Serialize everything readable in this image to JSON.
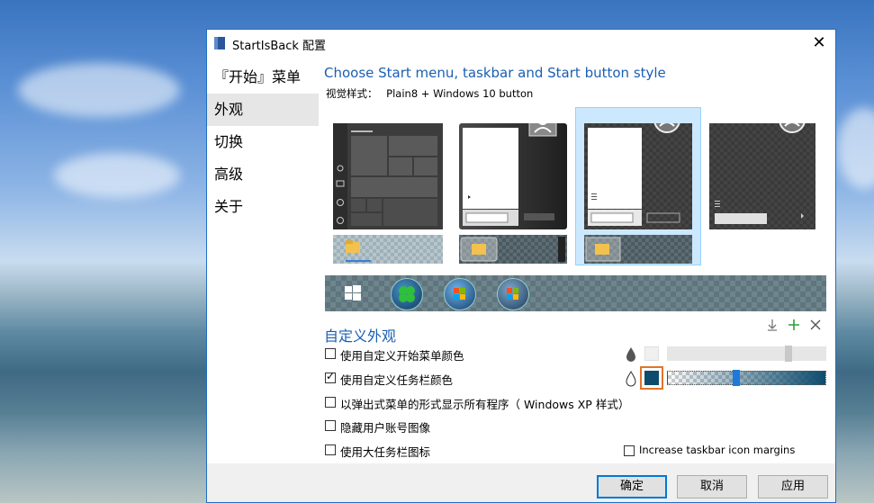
{
  "window": {
    "title": "StartIsBack 配置",
    "close_glyph": "✕"
  },
  "nav": {
    "items": [
      {
        "label": "『开始』菜单",
        "selected": false
      },
      {
        "label": "外观",
        "selected": true
      },
      {
        "label": "切换",
        "selected": false
      },
      {
        "label": "高级",
        "selected": false
      },
      {
        "label": "关于",
        "selected": false
      }
    ]
  },
  "main": {
    "heading": "Choose Start menu, taskbar and Start button style",
    "visual_style_label": "视觉样式：",
    "visual_style_value": "Plain8 + Windows 10 button",
    "customize_title": "自定义外观",
    "options": [
      {
        "label": "使用自定义开始菜单颜色",
        "checked": false
      },
      {
        "label": "使用自定义任务栏颜色",
        "checked": true
      },
      {
        "label": "以弹出式菜单的形式显示所有程序（ Windows XP 样式）",
        "checked": false
      },
      {
        "label": "隐藏用户账号图像",
        "checked": false
      },
      {
        "label": "使用大任务栏图标",
        "checked": false
      }
    ],
    "increase_margins_label": "Increase taskbar icon margins",
    "increase_margins_checked": false,
    "taskbar_color": "#0e4c6e",
    "highlight_color": "#e0752a"
  },
  "buttons": {
    "ok": "确定",
    "cancel": "取消",
    "apply": "应用"
  }
}
